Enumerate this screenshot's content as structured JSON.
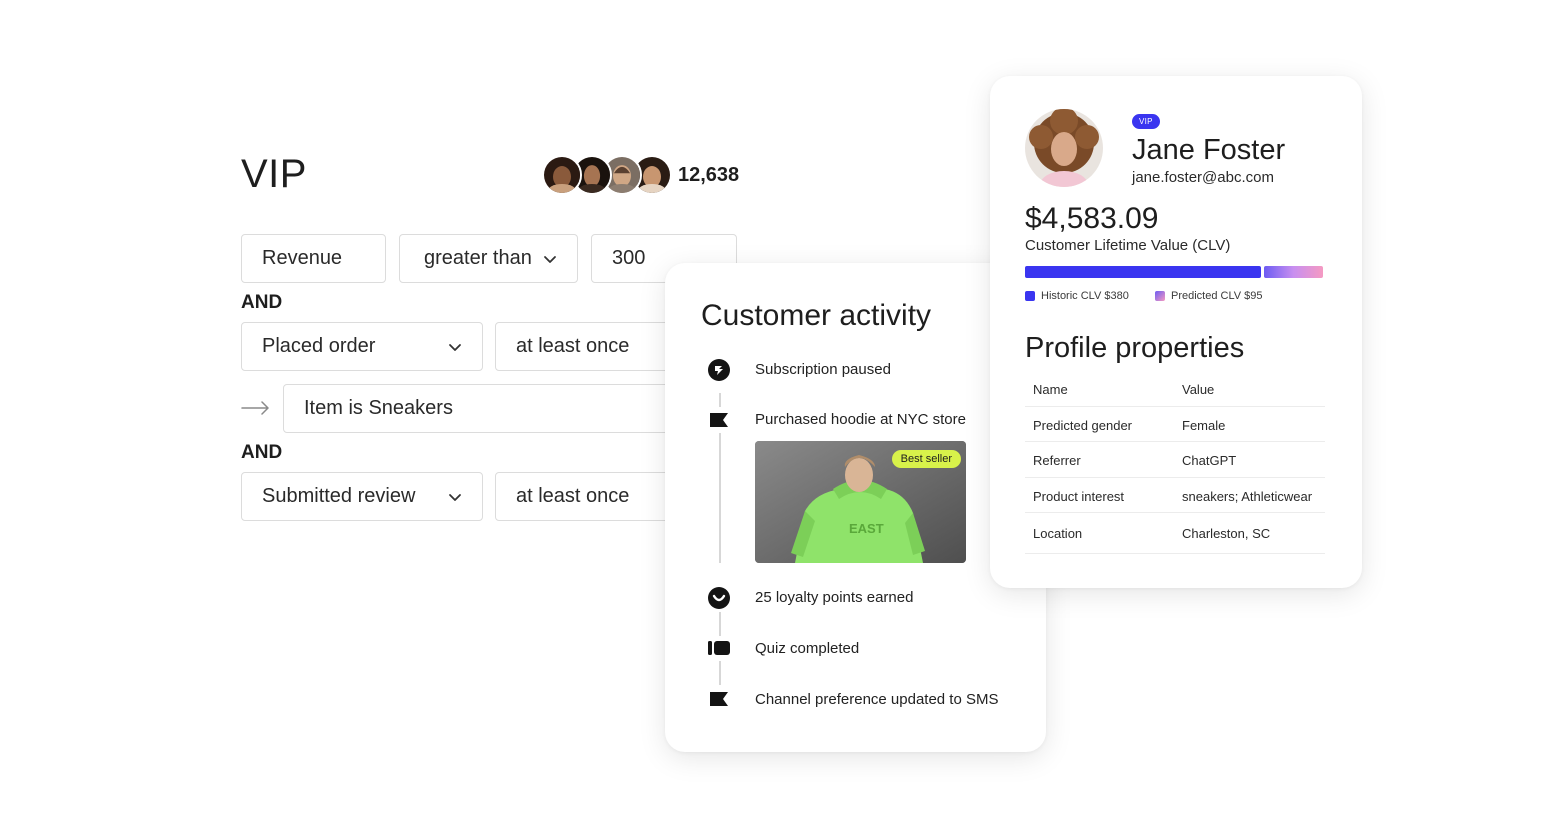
{
  "segment": {
    "title": "VIP",
    "member_count": "12,638",
    "conditions": {
      "revenue_field": "Revenue",
      "revenue_operator": "greater than",
      "revenue_value": "300",
      "and_1": "AND",
      "placed_order_metric": "Placed order",
      "placed_order_frequency": "at least once",
      "item_filter": "Item is Sneakers",
      "and_2": "AND",
      "review_metric": "Submitted review",
      "review_frequency": "at least once"
    }
  },
  "activity": {
    "title": "Customer activity",
    "events": [
      {
        "label": "Subscription paused",
        "icon": "subscription-icon"
      },
      {
        "label": "Purchased hoodie at NYC store",
        "icon": "flag-icon"
      },
      {
        "label": "25 loyalty points earned",
        "icon": "loyalty-icon"
      },
      {
        "label": "Quiz completed",
        "icon": "quiz-icon"
      },
      {
        "label": "Channel preference updated to SMS",
        "icon": "flag-icon"
      }
    ],
    "product_badge": "Best seller",
    "hoodie_print": "EAST"
  },
  "profile": {
    "badge": "VIP",
    "name": "Jane Foster",
    "email": "jane.foster@abc.com",
    "clv_amount": "$4,583.09",
    "clv_label": "Customer Lifetime Value (CLV)",
    "clv_bar": {
      "historic_value": 380,
      "predicted_value": 95
    },
    "legend_historic": "Historic CLV $380",
    "legend_predicted": "Predicted CLV $95",
    "properties_title": "Profile properties",
    "properties": {
      "header": {
        "key": "Name",
        "value": "Value"
      },
      "rows": [
        {
          "key": "Predicted gender",
          "value": "Female"
        },
        {
          "key": "Referrer",
          "value": "ChatGPT"
        },
        {
          "key": "Product interest",
          "value": "sneakers; Athleticwear"
        },
        {
          "key": "Location",
          "value": "Charleston, SC"
        }
      ]
    }
  },
  "colors": {
    "brand_blue": "#3a35f0",
    "best_seller_badge": "#d8f24a",
    "hoodie_green": "#8fe36a"
  }
}
